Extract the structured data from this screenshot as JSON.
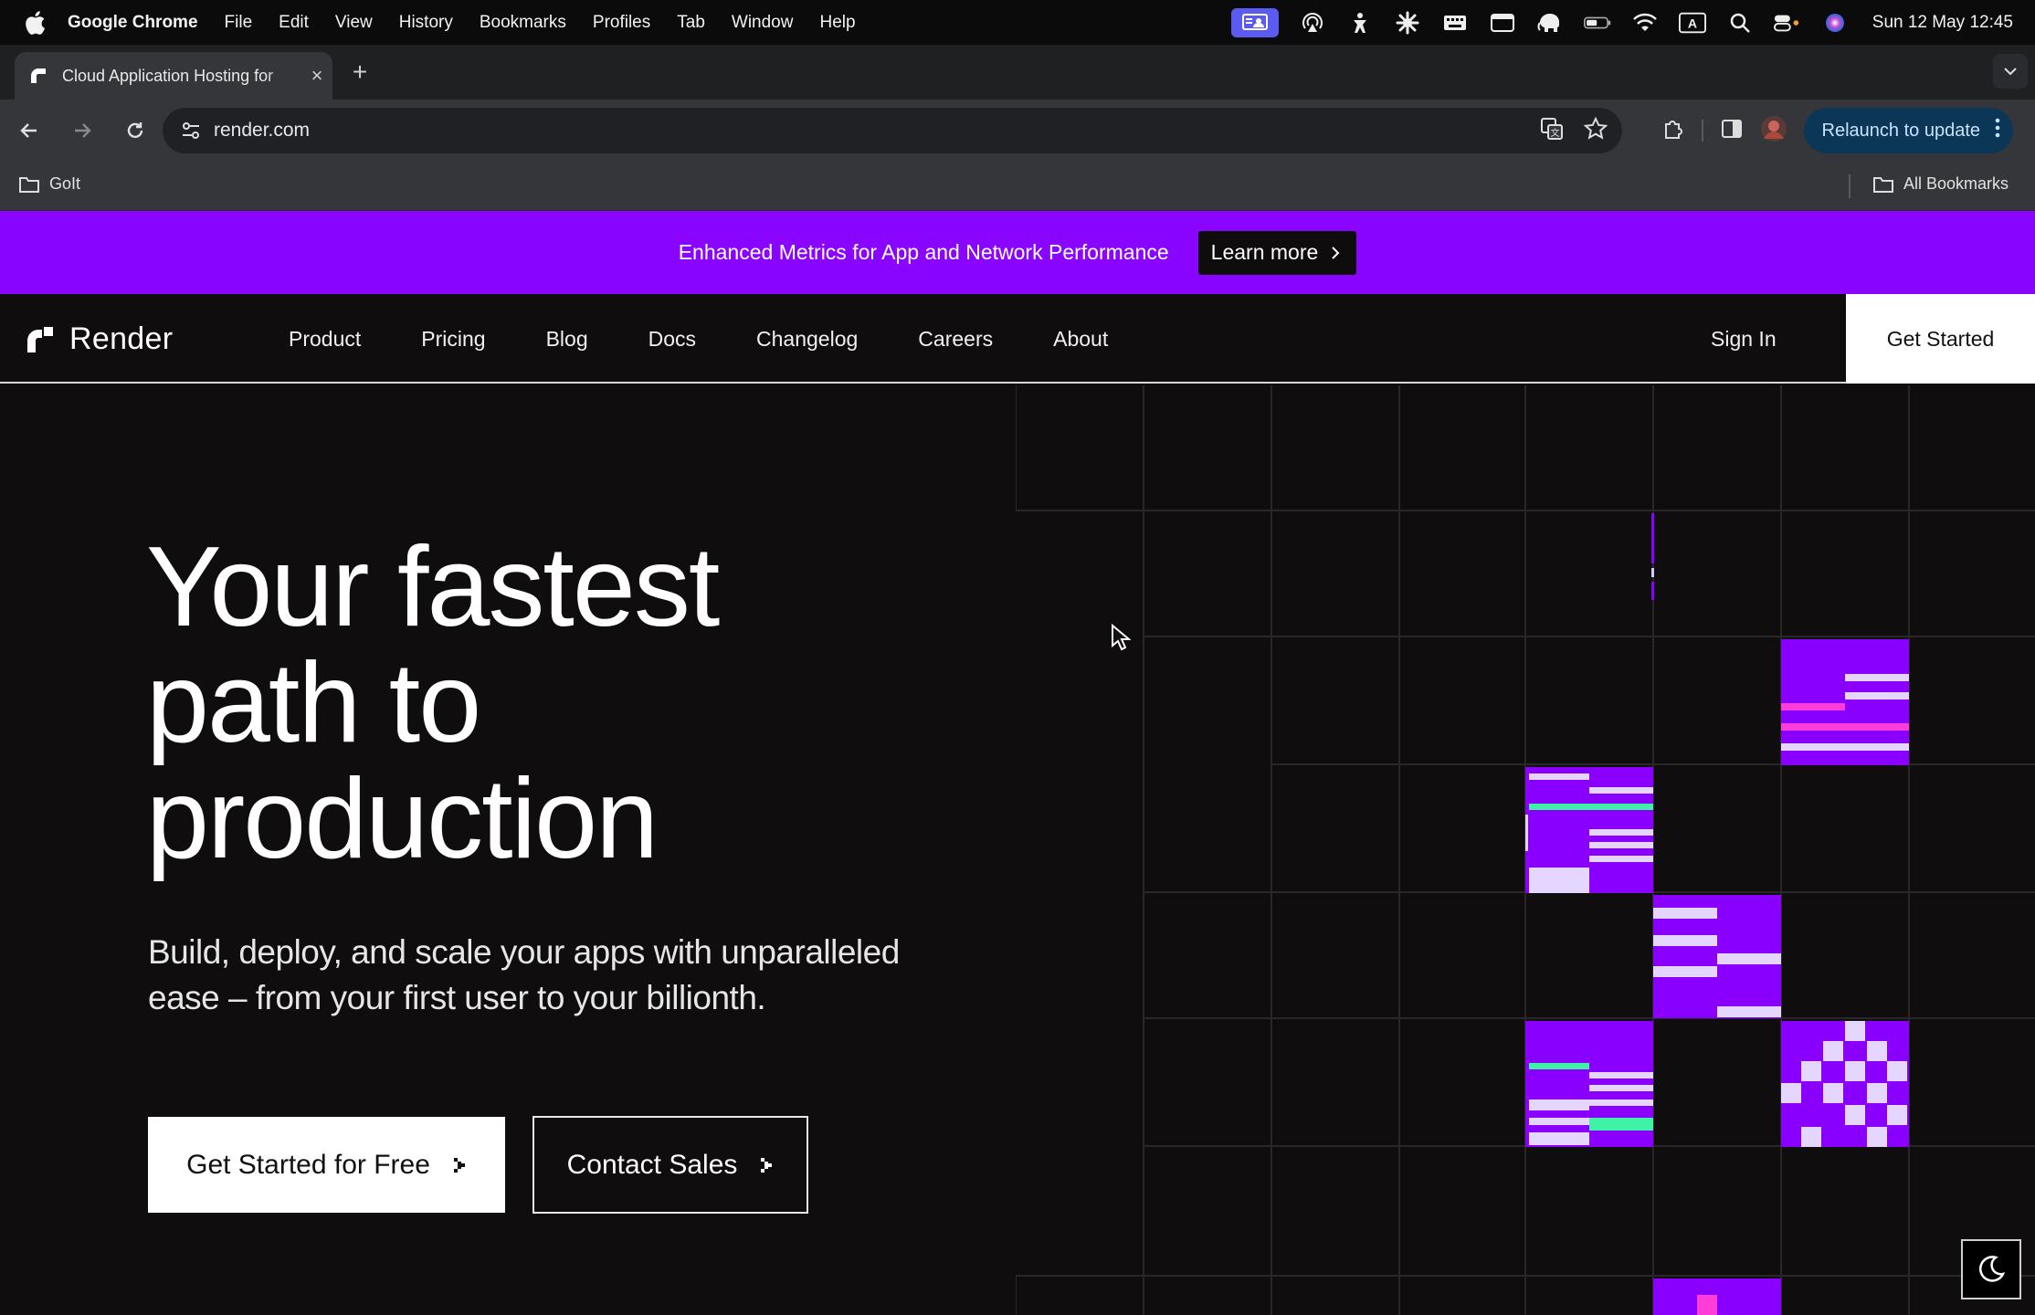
{
  "os_menubar": {
    "app_name": "Google Chrome",
    "menus": [
      "File",
      "Edit",
      "View",
      "History",
      "Bookmarks",
      "Profiles",
      "Tab",
      "Window",
      "Help"
    ],
    "status_icons": [
      "screen-share-icon",
      "airplay-icon",
      "user-figure-icon",
      "gear-asterisk-icon",
      "keyboard-icon",
      "window-icon",
      "elephant-icon",
      "battery-icon",
      "wifi-icon",
      "input-source-icon",
      "spotlight-search-icon",
      "control-center-icon",
      "siri-icon"
    ],
    "input_source_label": "A",
    "clock": "Sun 12 May  12:45"
  },
  "browser": {
    "tab_title": "Cloud Application Hosting for",
    "url": "render.com",
    "relaunch_label": "Relaunch to update",
    "bookmark_folder": "GoIt",
    "all_bookmarks": "All Bookmarks"
  },
  "banner": {
    "text": "Enhanced Metrics for App and Network Performance",
    "cta": "Learn more",
    "color": "#8a05ff"
  },
  "nav": {
    "brand": "Render",
    "links": [
      "Product",
      "Pricing",
      "Blog",
      "Docs",
      "Changelog",
      "Careers",
      "About"
    ],
    "sign_in": "Sign In",
    "get_started": "Get Started"
  },
  "hero": {
    "title_lines": [
      "Your fastest",
      "path to",
      "production"
    ],
    "subtitle_lines": [
      "Build, deploy, and scale your apps with unparalleled",
      "ease – from your first user to your billionth."
    ],
    "primary_cta": "Get Started for Free",
    "secondary_cta": "Contact Sales"
  },
  "colors": {
    "accent_purple": "#8a05ff",
    "tile_purple": "#8a00ff",
    "accent_pink": "#ff3dd8",
    "accent_green": "#3ff2a6",
    "page_bg": "#0f0d0e"
  }
}
